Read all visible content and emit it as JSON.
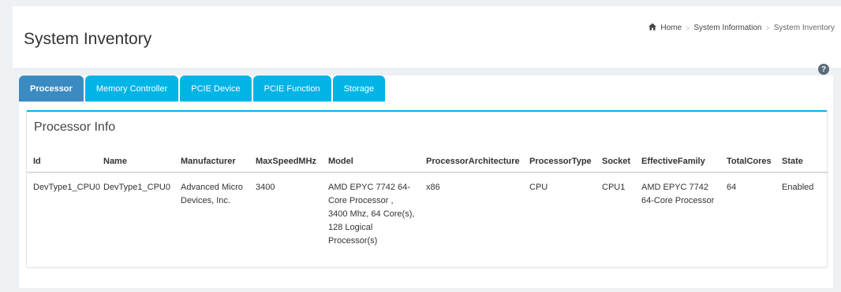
{
  "header": {
    "title": "System Inventory",
    "breadcrumb": [
      {
        "label": "Home",
        "icon": "home-icon"
      },
      {
        "label": "System Information"
      },
      {
        "label": "System Inventory"
      }
    ],
    "separator": ">",
    "help_icon": "?"
  },
  "tabs": [
    {
      "label": "Processor",
      "active": true
    },
    {
      "label": "Memory Controller",
      "active": false
    },
    {
      "label": "PCIE Device",
      "active": false
    },
    {
      "label": "PCIE Function",
      "active": false
    },
    {
      "label": "Storage",
      "active": false
    }
  ],
  "panel": {
    "title": "Processor Info",
    "columns": [
      "Id",
      "Name",
      "Manufacturer",
      "MaxSpeedMHz",
      "Model",
      "ProcessorArchitecture",
      "ProcessorType",
      "Socket",
      "EffectiveFamily",
      "TotalCores",
      "State"
    ],
    "rows": [
      {
        "id": "DevType1_CPU0",
        "name": "DevType1_CPU0",
        "manufacturer": [
          "Advanced Micro",
          "Devices, Inc."
        ],
        "max_speed": "3400",
        "model": [
          "AMD EPYC 7742 64-",
          "Core Processor ,",
          "3400 Mhz, 64 Core(s),",
          "128 Logical",
          "Processor(s)"
        ],
        "architecture": "x86",
        "processor_type": "CPU",
        "socket": "CPU1",
        "effective_family": [
          "AMD EPYC 7742",
          "64-Core Processor"
        ],
        "total_cores": "64",
        "state": "Enabled"
      }
    ]
  },
  "colors": {
    "tab": "#00b4e6",
    "tab_active": "#3b8bc2",
    "panel_accent": "#00b4e6",
    "background": "#eef1f4"
  }
}
